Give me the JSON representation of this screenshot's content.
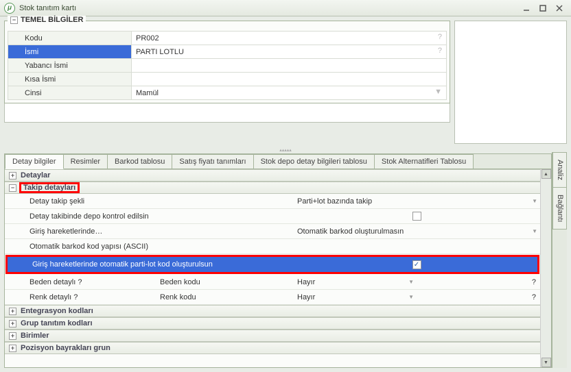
{
  "window": {
    "title": "Stok tanıtım kartı"
  },
  "basic_group": {
    "title": "TEMEL BİLGİLER",
    "expander": "−",
    "rows": {
      "kodu_label": "Kodu",
      "kodu_value": "PR002",
      "kodu_hint": "?",
      "ismi_label": "İsmi",
      "ismi_value": "PARTI LOTLU",
      "ismi_hint": "?",
      "yabanci_label": "Yabancı İsmi",
      "yabanci_value": "",
      "kisa_label": "Kısa İsmi",
      "kisa_value": "",
      "cinsi_label": "Cinsi",
      "cinsi_value": "Mamül"
    }
  },
  "tabs": {
    "t1": "Detay bilgiler",
    "t2": "Resimler",
    "t3": "Barkod tablosu",
    "t4": "Satış fiyatı tanımları",
    "t5": "Stok depo detay bilgileri tablosu",
    "t6": "Stok Alternatifleri Tablosu"
  },
  "vtabs": {
    "a": "Analiz",
    "b": "Bağlantı"
  },
  "acc": {
    "detaylar": "Detaylar",
    "takip": "Takip detayları",
    "entegrasyon": "Entegrasyon kodları",
    "grup": "Grup tanıtım kodları",
    "birimler": "Birimler",
    "poz": "Pozisyon bayrakları grun",
    "plus": "+",
    "minus": "−"
  },
  "details": {
    "r1_label": "Detay takip şekli",
    "r1_value": "Parti+lot bazında takip",
    "r2_label": "Detay takibinde depo kontrol edilsin",
    "r3_label": "Giriş hareketlerinde…",
    "r3_value": "Otomatik barkod oluşturulmasın",
    "r4_label": "Otomatik barkod kod yapısı (ASCII)",
    "r5_label": "Giriş hareketlerinde otomatik parti-lot kod oluşturulsun",
    "r6_label": "Beden detaylı ?",
    "r6_mid": "Beden kodu",
    "r6_value": "Hayır",
    "r6_hint": "?",
    "r7_label": "Renk detaylı ?",
    "r7_mid": "Renk kodu",
    "r7_value": "Hayır",
    "r7_hint": "?"
  }
}
